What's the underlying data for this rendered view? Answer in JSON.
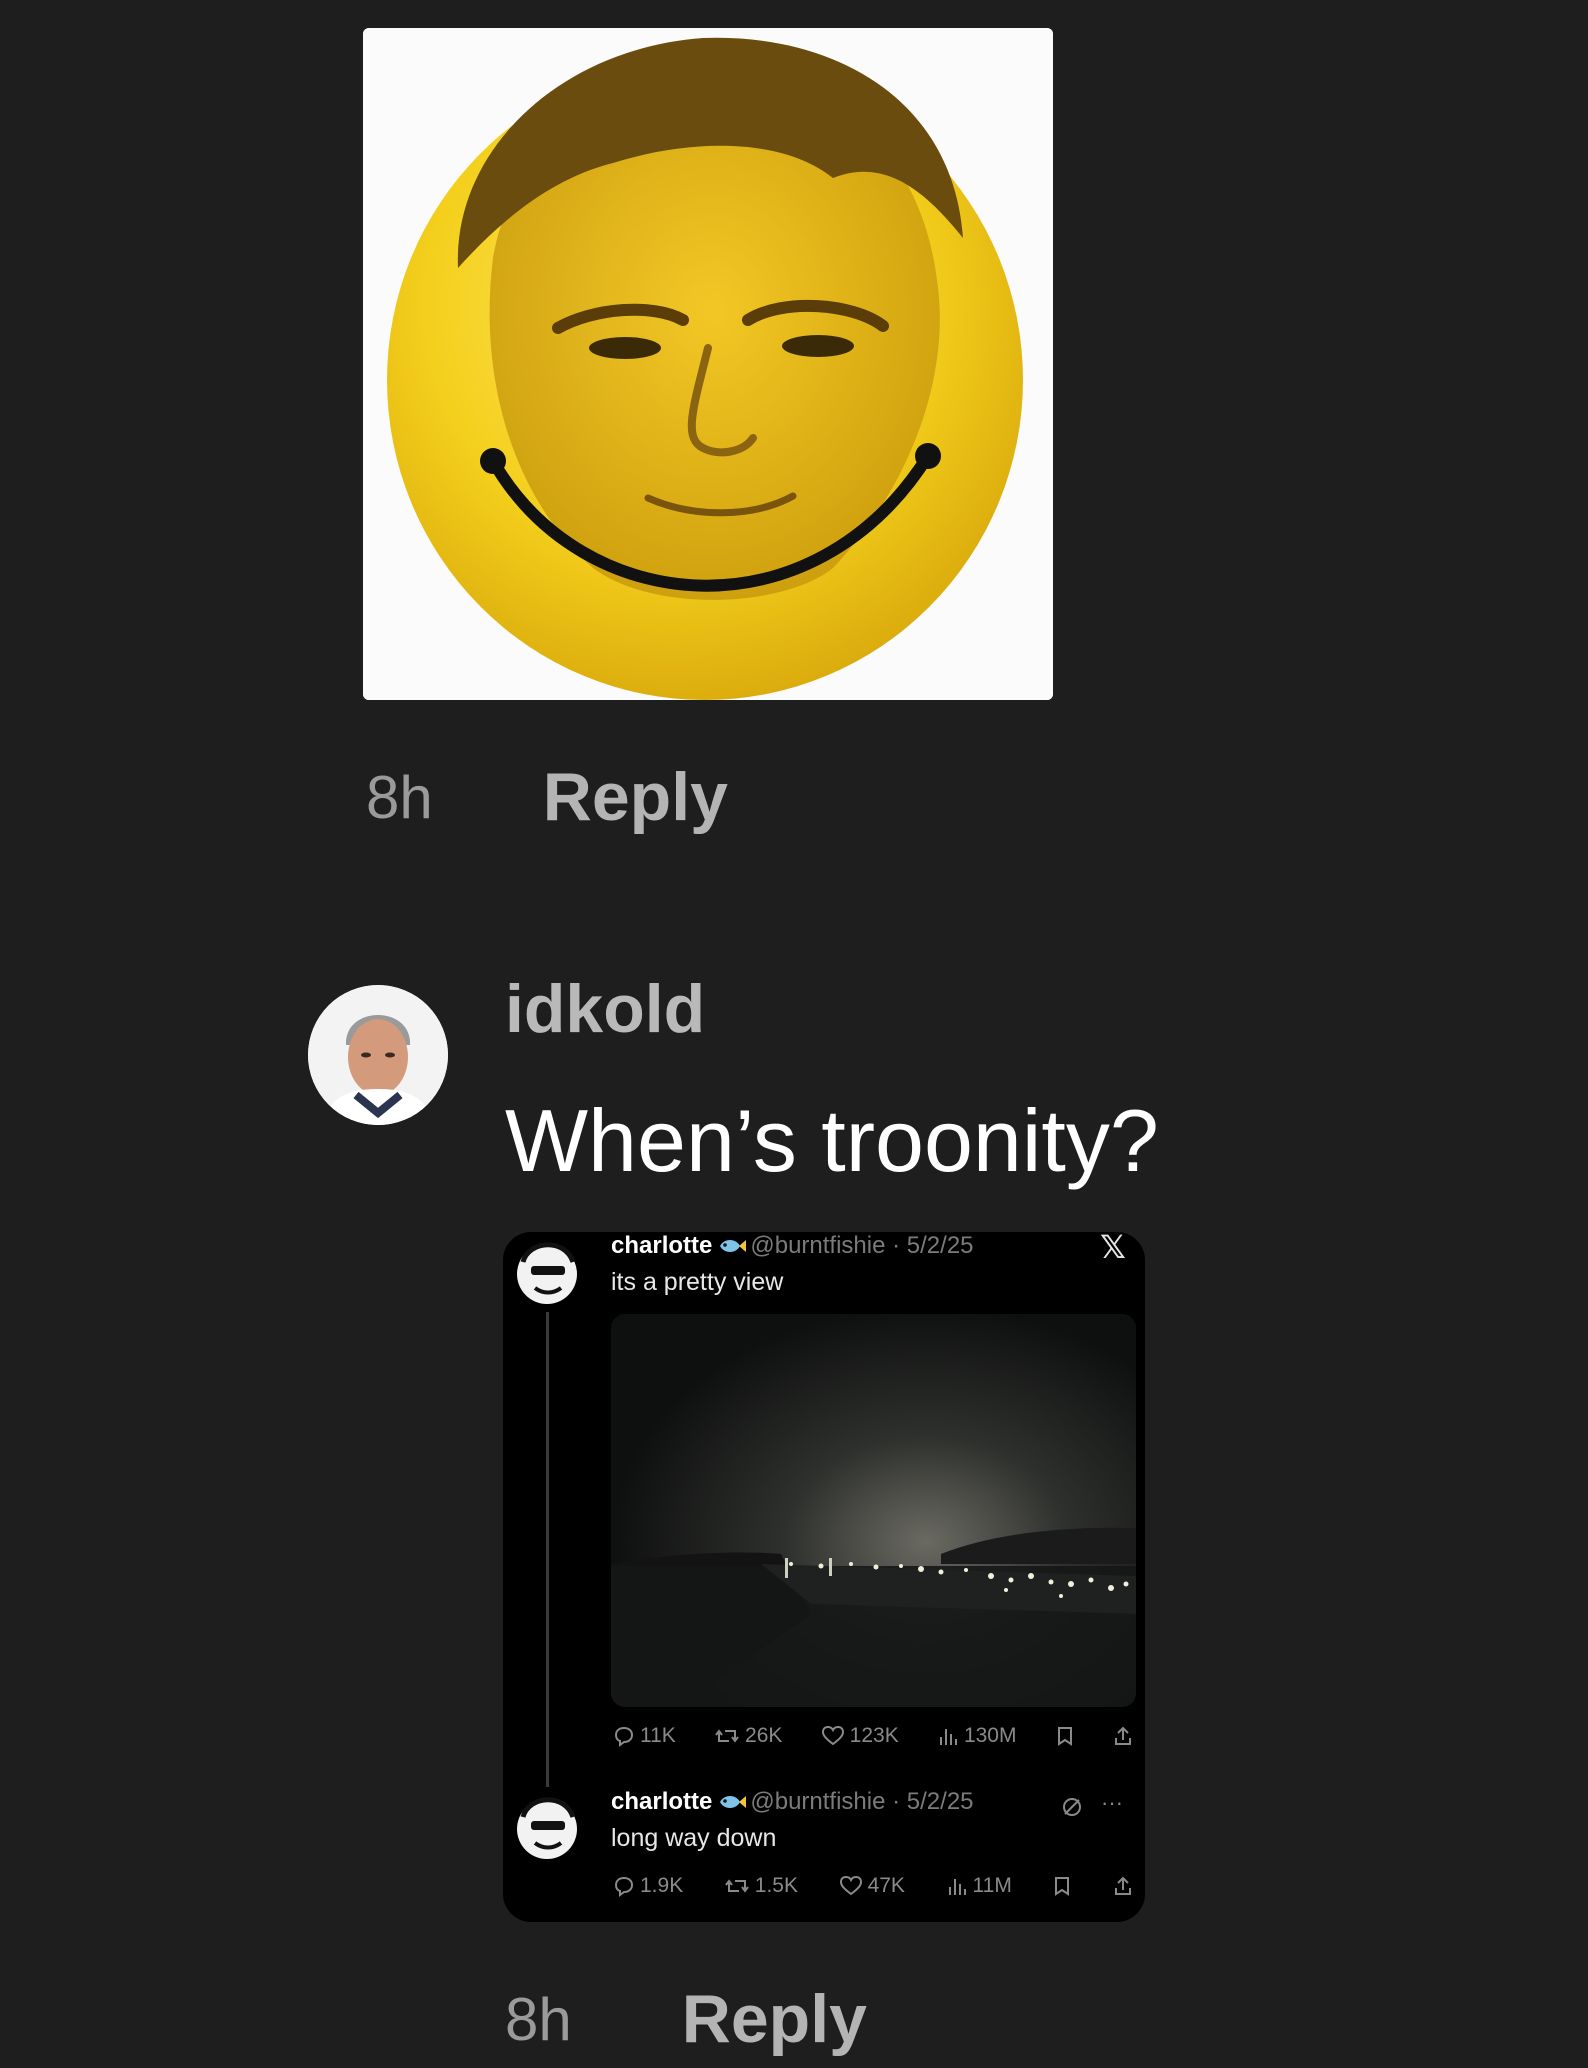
{
  "comment1": {
    "time": "8h",
    "reply_label": "Reply"
  },
  "comment2": {
    "username": "idkold",
    "text": "When’s troonity?",
    "time": "8h",
    "reply_label": "Reply"
  },
  "embed": {
    "logo": "𝕏",
    "tweet1": {
      "name": "charlotte",
      "handle_date": "@burntfishie · 5/2/25",
      "text": "its a pretty view",
      "replies": "11K",
      "reposts": "26K",
      "likes": "123K",
      "views": "130M"
    },
    "tweet2": {
      "name": "charlotte",
      "handle_date": "@burntfishie · 5/2/25",
      "text": "long way down",
      "replies": "1.9K",
      "reposts": "1.5K",
      "likes": "47K",
      "views": "11M"
    }
  },
  "icons": {
    "reply": "speech-bubble-icon",
    "repost": "repost-arrows-icon",
    "like": "heart-icon",
    "views": "bar-chart-icon",
    "bookmark": "bookmark-icon",
    "share": "share-icon",
    "fish": "fish-emoji-icon",
    "grok": "grok-icon",
    "more": "more-dots-icon"
  },
  "colors": {
    "background": "#1e1e1f",
    "smiley": "#f4cf1c",
    "embed_bg": "#000000"
  }
}
